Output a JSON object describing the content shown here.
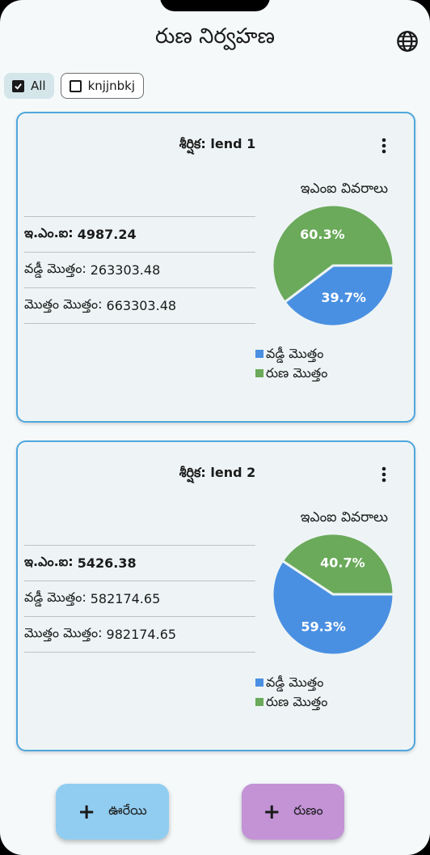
{
  "header": {
    "title": "రుణ నిర్వహణ",
    "globe_icon": "globe-icon"
  },
  "filters": [
    {
      "label": "All",
      "checked": true
    },
    {
      "label": "knjjnbkj",
      "checked": false
    }
  ],
  "colors": {
    "accent_border": "#4fa7dd",
    "interest_slice": "#4a90e2",
    "loan_slice": "#6aaa5a"
  },
  "loans": [
    {
      "title": "శీర్షిక: lend 1",
      "emi_heading": "ఇఎంఐ వివరాలు",
      "emi_label": "ఇ.ఎం.ఐ:",
      "emi_value": "4987.24",
      "interest_label": "వడ్డీ మొత్తం:",
      "interest_value": "263303.48",
      "total_label": "మొత్తం మొత్తం:",
      "total_value": "663303.48",
      "pie": {
        "interest_pct": 39.7,
        "loan_pct": 60.3,
        "interest_label": "39.7%",
        "loan_label": "60.3%"
      },
      "legend": [
        "వడ్డీ మొత్తం",
        "రుణ మొత్తం"
      ]
    },
    {
      "title": "శీర్షిక: lend 2",
      "emi_heading": "ఇఎంఐ వివరాలు",
      "emi_label": "ఇ.ఎం.ఐ:",
      "emi_value": "5426.38",
      "interest_label": "వడ్డీ మొత్తం:",
      "interest_value": "582174.65",
      "total_label": "మొత్తం మొత్తం:",
      "total_value": "982174.65",
      "pie": {
        "interest_pct": 59.3,
        "loan_pct": 40.7,
        "interest_label": "59.3%",
        "loan_label": "40.7%"
      },
      "legend": [
        "వడ్డీ మొత్తం",
        "రుణ మొత్తం"
      ]
    }
  ],
  "actions": {
    "borrower_label": "ఊరేయి",
    "loan_label": "రుణం"
  }
}
